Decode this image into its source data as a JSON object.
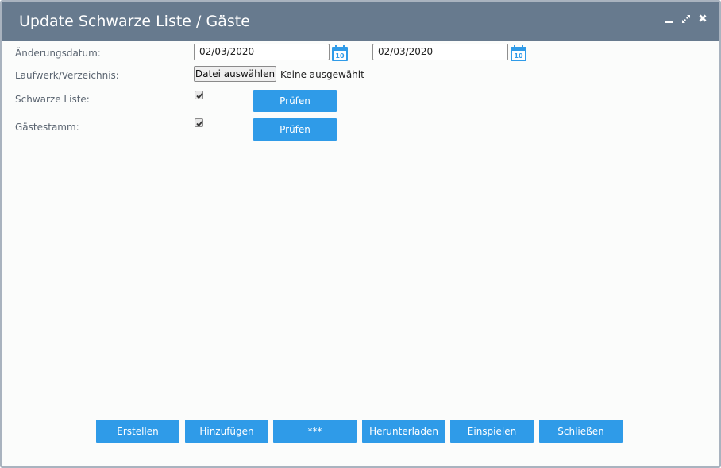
{
  "window": {
    "title": "Update Schwarze Liste / Gäste",
    "controls": [
      "minimize-icon",
      "maximize-icon",
      "close-icon"
    ]
  },
  "form": {
    "change_date": {
      "label": "Änderungsdatum:",
      "from_value": "02/03/2020",
      "to_value": "02/03/2020",
      "calendar_icon_day": "10"
    },
    "drive_directory": {
      "label": "Laufwerk/Verzeichnis:",
      "button_label": "Datei auswählen",
      "status": "Keine ausgewählt"
    },
    "blacklist": {
      "label": "Schwarze Liste:",
      "checked": true,
      "check_button": "Prüfen"
    },
    "guest_master": {
      "label": "Gästestamm:",
      "checked": true,
      "check_button": "Prüfen"
    }
  },
  "footer": {
    "buttons": [
      "Erstellen",
      "Hinzufügen",
      "***",
      "Herunterladen",
      "Einspielen",
      "Schließen"
    ]
  },
  "colors": {
    "titlebar": "#677a8e",
    "button": "#2f9be8",
    "label": "#5a6470",
    "background": "#fbfcfb"
  }
}
